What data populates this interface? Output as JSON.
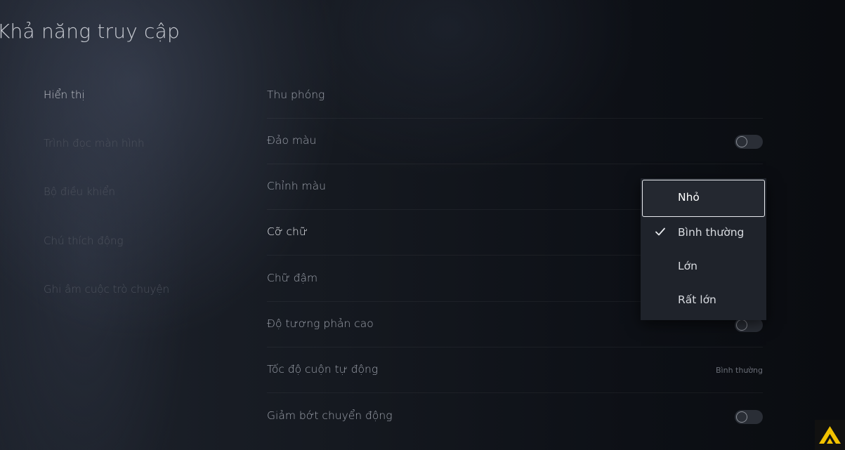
{
  "page": {
    "title": "Khả năng truy cập"
  },
  "sidebar": {
    "items": [
      {
        "label": "Hiển thị",
        "active": true
      },
      {
        "label": "Trình đọc màn hình",
        "active": false
      },
      {
        "label": "Bộ điều khiển",
        "active": false
      },
      {
        "label": "Chú thích động",
        "active": false
      },
      {
        "label": "Ghi âm cuộc trò chuyện",
        "active": false
      }
    ]
  },
  "settings": {
    "rows": [
      {
        "label": "Thu phóng"
      },
      {
        "label": "Đảo màu",
        "toggle": "off"
      },
      {
        "label": "Chỉnh màu"
      },
      {
        "label": "Cỡ chữ",
        "focused": true
      },
      {
        "label": "Chữ đậm"
      },
      {
        "label": "Độ tương phản cao",
        "toggle": "off"
      },
      {
        "label": "Tốc độ cuộn tự động",
        "value": "Bình thường"
      },
      {
        "label": "Giảm bớt chuyển động",
        "toggle": "off"
      }
    ]
  },
  "dropdown": {
    "options": [
      {
        "label": "Nhỏ",
        "highlighted": true,
        "selected": false
      },
      {
        "label": "Bình thường",
        "highlighted": false,
        "selected": true
      },
      {
        "label": "Lớn",
        "highlighted": false,
        "selected": false
      },
      {
        "label": "Rất lớn",
        "highlighted": false,
        "selected": false
      }
    ]
  },
  "icons": {
    "check": "check-icon",
    "logo": "brand-logo-icon"
  },
  "colors": {
    "logo_accent": "#f2c200"
  }
}
